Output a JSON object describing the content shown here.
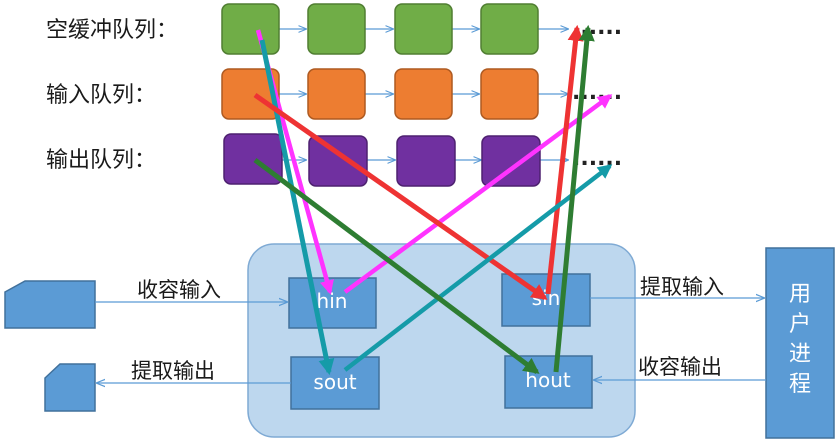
{
  "queues": {
    "empty_label": "空缓冲队列：",
    "input_label": "输入队列：",
    "output_label": "输出队列：",
    "empty_color": "#70ad47",
    "input_color": "#ed7d31",
    "output_color": "#7030a0",
    "ellipsis": "......"
  },
  "buffers": {
    "hin": "hin",
    "sin": "sin",
    "sout": "sout",
    "hout": "hout",
    "buffer_color": "#5b9bd5",
    "area_color": "#bdd7ee"
  },
  "flows": {
    "collect_input": "收容输入",
    "extract_output": "提取输出",
    "extract_input": "提取输入",
    "collect_output": "收容输出"
  },
  "process": {
    "label_line1": "用",
    "label_line2": "户",
    "label_line3": "进",
    "label_line4": "程",
    "color": "#5b9bd5"
  },
  "arrow_colors": {
    "magenta": "#ff33ff",
    "red": "#ee3333",
    "teal": "#159ba8",
    "green": "#2e7d32"
  }
}
